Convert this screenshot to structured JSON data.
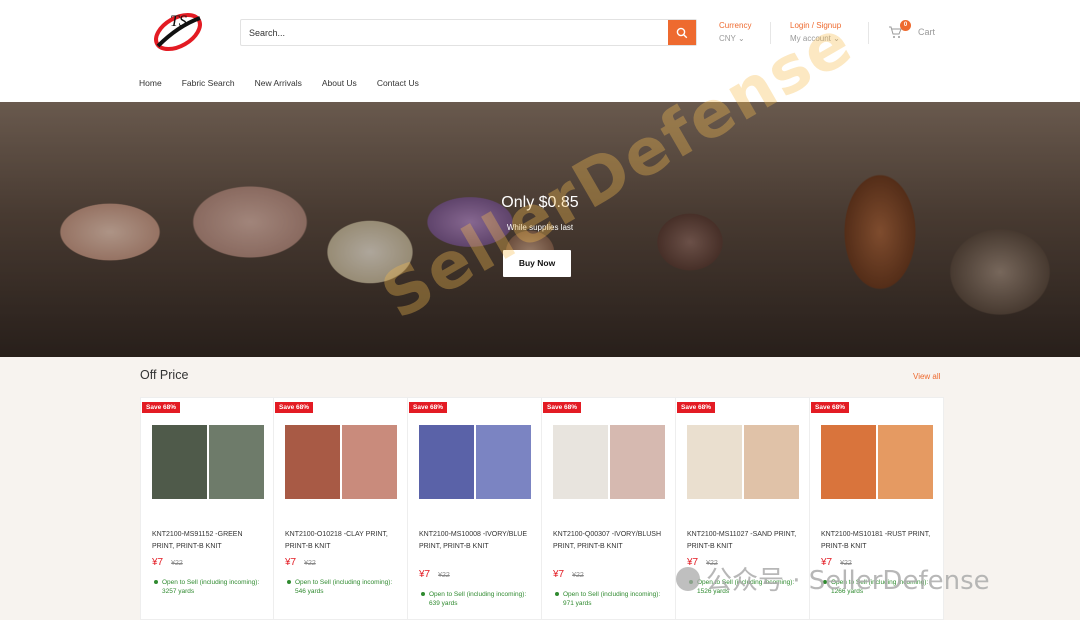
{
  "header": {
    "search_placeholder": "Search...",
    "currency_label": "Currency",
    "currency_value": "CNY",
    "login_label": "Login / Signup",
    "account_label": "My account",
    "cart_count": "0",
    "cart_label": "Cart"
  },
  "nav": [
    "Home",
    "Fabric Search",
    "New Arrivals",
    "About Us",
    "Contact Us"
  ],
  "hero": {
    "title": "Only $0.85",
    "subtitle": "While supplies last",
    "button": "Buy Now"
  },
  "section": {
    "title": "Off Price",
    "view_all": "View all"
  },
  "products": [
    {
      "badge": "Save 68%",
      "name": "KNT2100-MS91152 -GREEN PRINT, PRINT-B KNIT",
      "price": "¥7",
      "old_price": "¥22",
      "stock": "Open to Sell (including incoming): 3257 yards",
      "colors": [
        "#4f5a4a",
        "#6e7b6a"
      ]
    },
    {
      "badge": "Save 68%",
      "name": "KNT2100-O10218 -CLAY PRINT, PRINT-B KNIT",
      "price": "¥7",
      "old_price": "¥22",
      "stock": "Open to Sell (including incoming): 546 yards",
      "colors": [
        "#a85a45",
        "#c98b7c"
      ]
    },
    {
      "badge": "Save 68%",
      "name": "KNT2100-MS10008 -IVORY/BLUE PRINT, PRINT-B KNIT",
      "price": "¥7",
      "old_price": "¥22",
      "stock": "Open to Sell (including incoming): 639 yards",
      "colors": [
        "#5a62a8",
        "#7b84c2"
      ]
    },
    {
      "badge": "Save 68%",
      "name": "KNT2100-Q00307 -IVORY/BLUSH PRINT, PRINT-B KNIT",
      "price": "¥7",
      "old_price": "¥22",
      "stock": "Open to Sell (including incoming): 971 yards",
      "colors": [
        "#e8e4de",
        "#d6b9b0"
      ]
    },
    {
      "badge": "Save 68%",
      "name": "KNT2100-MS11027 -SAND PRINT, PRINT-B KNIT",
      "price": "¥7",
      "old_price": "¥22",
      "stock": "Open to Sell (including incoming): 1526 yards",
      "colors": [
        "#eadfcf",
        "#e0c2a8"
      ]
    },
    {
      "badge": "Save 68%",
      "name": "KNT2100-MS10181 -RUST PRINT, PRINT-B KNIT",
      "price": "¥7",
      "old_price": "¥22",
      "stock": "Open to Sell (including incoming): 1266 yards",
      "colors": [
        "#d9743c",
        "#e59a62"
      ]
    }
  ],
  "watermark": {
    "diagonal": "SellerDefense",
    "bottom": "公众号 · SellerDefense"
  }
}
